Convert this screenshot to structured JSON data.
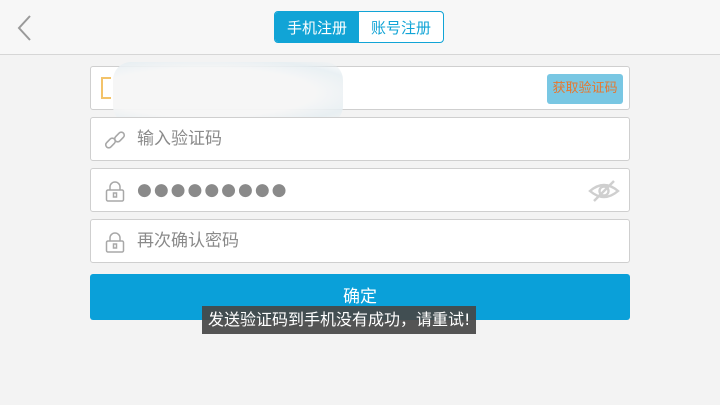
{
  "header": {
    "tabs": [
      {
        "label": "手机注册",
        "active": true
      },
      {
        "label": "账号注册",
        "active": false
      }
    ]
  },
  "form": {
    "phone_field": {
      "value": "",
      "get_code_label": "获取验证码"
    },
    "code_field": {
      "placeholder": "输入验证码"
    },
    "password_field": {
      "masked_value": "●●●●●●●●●"
    },
    "confirm_password_field": {
      "placeholder": "再次确认密码"
    },
    "confirm_button_label": "确定"
  },
  "toast": {
    "message": "发送验证码到手机没有成功，请重试!"
  },
  "colors": {
    "accent": "#0aa0d9",
    "get_code_text": "#e7772e"
  },
  "icons": [
    "back-chevron-icon",
    "phone-icon",
    "link-icon",
    "lock-icon",
    "eye-off-icon",
    "lock-icon"
  ]
}
